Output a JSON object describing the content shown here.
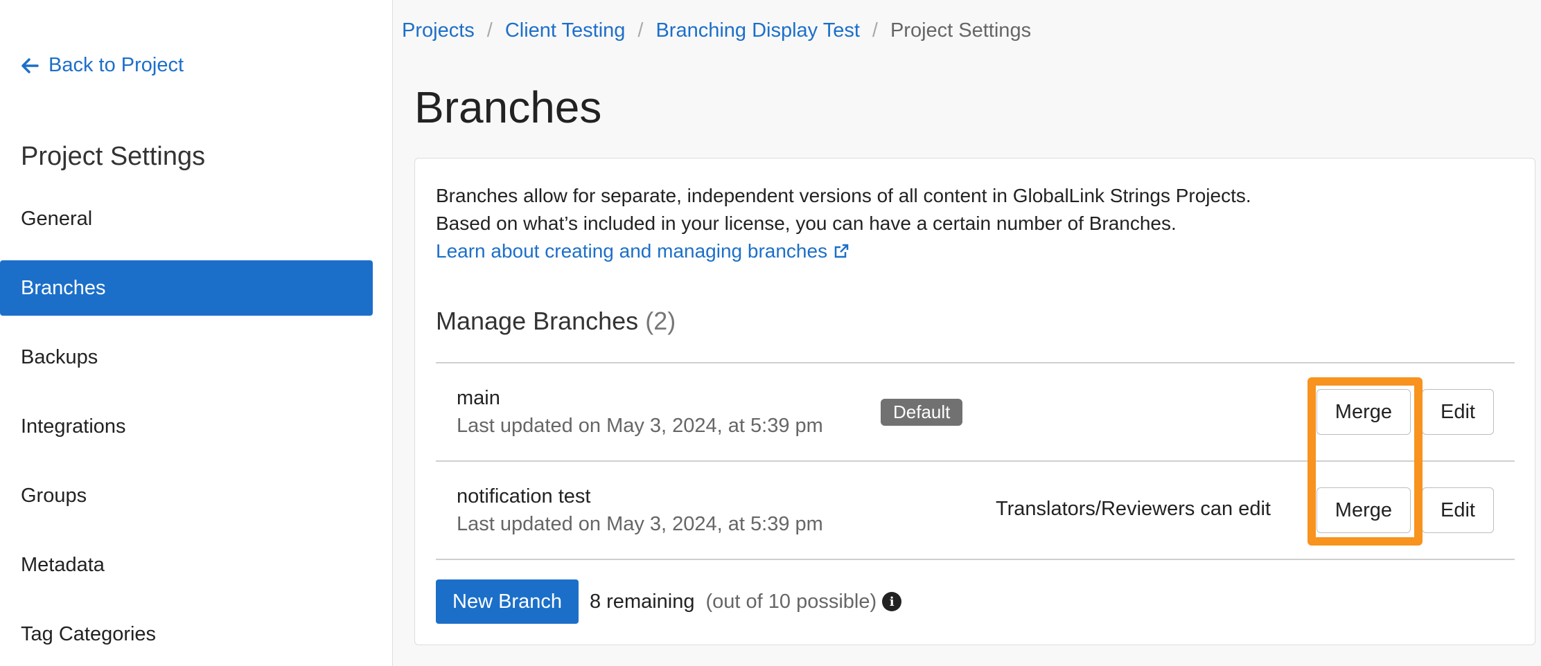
{
  "sidebar": {
    "back_label": "Back to Project",
    "title": "Project Settings",
    "items": [
      {
        "label": "General"
      },
      {
        "label": "Branches",
        "active": true
      },
      {
        "label": "Backups"
      },
      {
        "label": "Integrations"
      },
      {
        "label": "Groups"
      },
      {
        "label": "Metadata"
      },
      {
        "label": "Tag Categories"
      }
    ]
  },
  "breadcrumb": {
    "items": [
      "Projects",
      "Client Testing",
      "Branching Display Test"
    ],
    "separator": "/",
    "current": "Project Settings"
  },
  "page": {
    "title": "Branches"
  },
  "intro": {
    "line1": "Branches allow for separate, independent versions of all content in GlobalLink Strings Projects.",
    "line2": "Based on what’s included in your license, you can have a certain number of Branches.",
    "learn_link": "Learn about creating and managing branches"
  },
  "manage": {
    "title": "Manage Branches",
    "count": "(2)"
  },
  "branches": [
    {
      "name": "main",
      "updated": "Last updated on May 3, 2024, at 5:39 pm",
      "badge": "Default",
      "merge_label": "Merge",
      "edit_label": "Edit"
    },
    {
      "name": "notification test",
      "updated": "Last updated on May 3, 2024, at 5:39 pm",
      "permission": "Translators/Reviewers can edit",
      "merge_label": "Merge",
      "edit_label": "Edit"
    }
  ],
  "footer": {
    "new_branch_label": "New Branch",
    "remaining": "8 remaining",
    "possible": "(out of 10 possible)",
    "info_glyph": "i"
  },
  "colors": {
    "accent": "#1c6fc9",
    "highlight": "#f7931e",
    "badge": "#717171"
  },
  "icons": {
    "back": "arrow-left-icon",
    "external": "external-link-icon",
    "info": "info-circle-icon"
  }
}
